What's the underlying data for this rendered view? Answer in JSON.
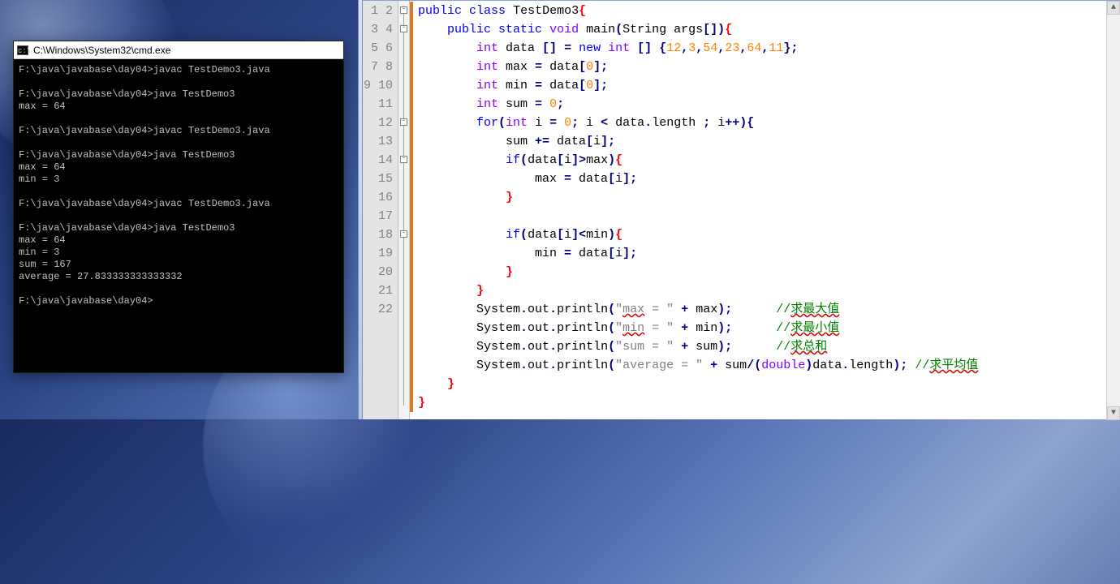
{
  "cmd": {
    "title": "C:\\Windows\\System32\\cmd.exe",
    "icon": "c:\\",
    "output": "F:\\java\\javabase\\day04>javac TestDemo3.java\n\nF:\\java\\javabase\\day04>java TestDemo3\nmax = 64\n\nF:\\java\\javabase\\day04>javac TestDemo3.java\n\nF:\\java\\javabase\\day04>java TestDemo3\nmax = 64\nmin = 3\n\nF:\\java\\javabase\\day04>javac TestDemo3.java\n\nF:\\java\\javabase\\day04>java TestDemo3\nmax = 64\nmin = 3\nsum = 167\naverage = 27.833333333333332\n\nF:\\java\\javabase\\day04>"
  },
  "editor": {
    "line_count": 22,
    "fold_boxes": [
      1,
      2,
      7,
      9,
      13
    ],
    "change_bar": {
      "from": 1,
      "to": 22
    },
    "code_tokens": [
      [
        [
          "kw",
          "public"
        ],
        [
          "",
          " "
        ],
        [
          "kw",
          "class"
        ],
        [
          "",
          " "
        ],
        [
          "cls",
          "TestDemo3"
        ],
        [
          "brR",
          "{"
        ]
      ],
      [
        [
          "",
          "    "
        ],
        [
          "kw",
          "public"
        ],
        [
          "",
          " "
        ],
        [
          "kw",
          "static"
        ],
        [
          "",
          " "
        ],
        [
          "typ",
          "void"
        ],
        [
          "",
          " "
        ],
        [
          "",
          "main"
        ],
        [
          "pun",
          "("
        ],
        [
          "",
          "String args"
        ],
        [
          "pun",
          "[])"
        ],
        [
          "brR",
          "{"
        ]
      ],
      [
        [
          "",
          "        "
        ],
        [
          "typ",
          "int"
        ],
        [
          "",
          " data "
        ],
        [
          "pun",
          "[]"
        ],
        [
          "",
          " "
        ],
        [
          "pun",
          "="
        ],
        [
          "",
          " "
        ],
        [
          "kw",
          "new"
        ],
        [
          "",
          " "
        ],
        [
          "typ",
          "int"
        ],
        [
          "",
          " "
        ],
        [
          "pun",
          "[]"
        ],
        [
          "",
          " "
        ],
        [
          "pun",
          "{"
        ],
        [
          "num",
          "12"
        ],
        [
          "pun",
          ","
        ],
        [
          "num",
          "3"
        ],
        [
          "pun",
          ","
        ],
        [
          "num",
          "54"
        ],
        [
          "pun",
          ","
        ],
        [
          "num",
          "23"
        ],
        [
          "pun",
          ","
        ],
        [
          "num",
          "64"
        ],
        [
          "pun",
          ","
        ],
        [
          "num",
          "11"
        ],
        [
          "pun",
          "};"
        ]
      ],
      [
        [
          "",
          "        "
        ],
        [
          "typ",
          "int"
        ],
        [
          "",
          " max "
        ],
        [
          "pun",
          "="
        ],
        [
          "",
          " data"
        ],
        [
          "pun",
          "["
        ],
        [
          "num",
          "0"
        ],
        [
          "pun",
          "];"
        ]
      ],
      [
        [
          "",
          "        "
        ],
        [
          "typ",
          "int"
        ],
        [
          "",
          " min "
        ],
        [
          "pun",
          "="
        ],
        [
          "",
          " data"
        ],
        [
          "pun",
          "["
        ],
        [
          "num",
          "0"
        ],
        [
          "pun",
          "];"
        ]
      ],
      [
        [
          "",
          "        "
        ],
        [
          "typ",
          "int"
        ],
        [
          "",
          " sum "
        ],
        [
          "pun",
          "="
        ],
        [
          "",
          " "
        ],
        [
          "num",
          "0"
        ],
        [
          "pun",
          ";"
        ]
      ],
      [
        [
          "",
          "        "
        ],
        [
          "kw",
          "for"
        ],
        [
          "pun",
          "("
        ],
        [
          "typ",
          "int"
        ],
        [
          "",
          " i "
        ],
        [
          "pun",
          "="
        ],
        [
          "",
          " "
        ],
        [
          "num",
          "0"
        ],
        [
          "pun",
          ";"
        ],
        [
          "",
          " i "
        ],
        [
          "pun",
          "<"
        ],
        [
          "",
          " data"
        ],
        [
          "pun",
          "."
        ],
        [
          "",
          "length "
        ],
        [
          "pun",
          ";"
        ],
        [
          "",
          " i"
        ],
        [
          "pun",
          "++){"
        ]
      ],
      [
        [
          "",
          "            sum "
        ],
        [
          "pun",
          "+="
        ],
        [
          "",
          " data"
        ],
        [
          "pun",
          "["
        ],
        [
          "",
          "i"
        ],
        [
          "pun",
          "];"
        ]
      ],
      [
        [
          "",
          "            "
        ],
        [
          "kw",
          "if"
        ],
        [
          "pun",
          "("
        ],
        [
          "",
          "data"
        ],
        [
          "pun",
          "["
        ],
        [
          "",
          "i"
        ],
        [
          "pun",
          "]>"
        ],
        [
          "",
          "max"
        ],
        [
          "pun",
          ")"
        ],
        [
          "brR",
          "{"
        ]
      ],
      [
        [
          "",
          "                max "
        ],
        [
          "pun",
          "="
        ],
        [
          "",
          " data"
        ],
        [
          "pun",
          "["
        ],
        [
          "",
          "i"
        ],
        [
          "pun",
          "];"
        ]
      ],
      [
        [
          "",
          "            "
        ],
        [
          "brR",
          "}"
        ]
      ],
      [
        [
          "",
          ""
        ]
      ],
      [
        [
          "",
          "            "
        ],
        [
          "kw",
          "if"
        ],
        [
          "pun",
          "("
        ],
        [
          "",
          "data"
        ],
        [
          "pun",
          "["
        ],
        [
          "",
          "i"
        ],
        [
          "pun",
          "]<"
        ],
        [
          "",
          "min"
        ],
        [
          "pun",
          ")"
        ],
        [
          "brR",
          "{"
        ]
      ],
      [
        [
          "",
          "                min "
        ],
        [
          "pun",
          "="
        ],
        [
          "",
          " data"
        ],
        [
          "pun",
          "["
        ],
        [
          "",
          "i"
        ],
        [
          "pun",
          "];"
        ]
      ],
      [
        [
          "",
          "            "
        ],
        [
          "brR",
          "}"
        ]
      ],
      [
        [
          "",
          "        "
        ],
        [
          "brR",
          "}"
        ]
      ],
      [
        [
          "",
          "        System"
        ],
        [
          "pun",
          "."
        ],
        [
          "",
          "out"
        ],
        [
          "pun",
          "."
        ],
        [
          "",
          "println"
        ],
        [
          "pun",
          "("
        ],
        [
          "str",
          "\""
        ],
        [
          "strw",
          "max"
        ],
        [
          "str",
          " = \""
        ],
        [
          "",
          " "
        ],
        [
          "pun",
          "+"
        ],
        [
          "",
          " max"
        ],
        [
          "pun",
          ");"
        ],
        [
          "",
          "      "
        ],
        [
          "cmt",
          "//"
        ],
        [
          "cmtw",
          "求最大值"
        ]
      ],
      [
        [
          "",
          "        System"
        ],
        [
          "pun",
          "."
        ],
        [
          "",
          "out"
        ],
        [
          "pun",
          "."
        ],
        [
          "",
          "println"
        ],
        [
          "pun",
          "("
        ],
        [
          "str",
          "\""
        ],
        [
          "strw",
          "min"
        ],
        [
          "str",
          " = \""
        ],
        [
          "",
          " "
        ],
        [
          "pun",
          "+"
        ],
        [
          "",
          " min"
        ],
        [
          "pun",
          ");"
        ],
        [
          "",
          "      "
        ],
        [
          "cmt",
          "//"
        ],
        [
          "cmtw",
          "求最小值"
        ]
      ],
      [
        [
          "",
          "        System"
        ],
        [
          "pun",
          "."
        ],
        [
          "",
          "out"
        ],
        [
          "pun",
          "."
        ],
        [
          "",
          "println"
        ],
        [
          "pun",
          "("
        ],
        [
          "str",
          "\"sum = \""
        ],
        [
          "",
          " "
        ],
        [
          "pun",
          "+"
        ],
        [
          "",
          " sum"
        ],
        [
          "pun",
          ");"
        ],
        [
          "",
          "      "
        ],
        [
          "cmt",
          "//"
        ],
        [
          "cmtw",
          "求总和"
        ]
      ],
      [
        [
          "",
          "        System"
        ],
        [
          "pun",
          "."
        ],
        [
          "",
          "out"
        ],
        [
          "pun",
          "."
        ],
        [
          "",
          "println"
        ],
        [
          "pun",
          "("
        ],
        [
          "str",
          "\"average = \""
        ],
        [
          "",
          " "
        ],
        [
          "pun",
          "+"
        ],
        [
          "",
          " sum"
        ],
        [
          "pun",
          "/("
        ],
        [
          "typ",
          "double"
        ],
        [
          "pun",
          ")"
        ],
        [
          "",
          "data"
        ],
        [
          "pun",
          "."
        ],
        [
          "",
          "length"
        ],
        [
          "pun",
          ");"
        ],
        [
          "",
          " "
        ],
        [
          "cmt",
          "//"
        ],
        [
          "cmtw",
          "求平均值"
        ]
      ],
      [
        [
          "",
          "    "
        ],
        [
          "brR",
          "}"
        ]
      ],
      [
        [
          "brR",
          "}"
        ]
      ]
    ]
  }
}
